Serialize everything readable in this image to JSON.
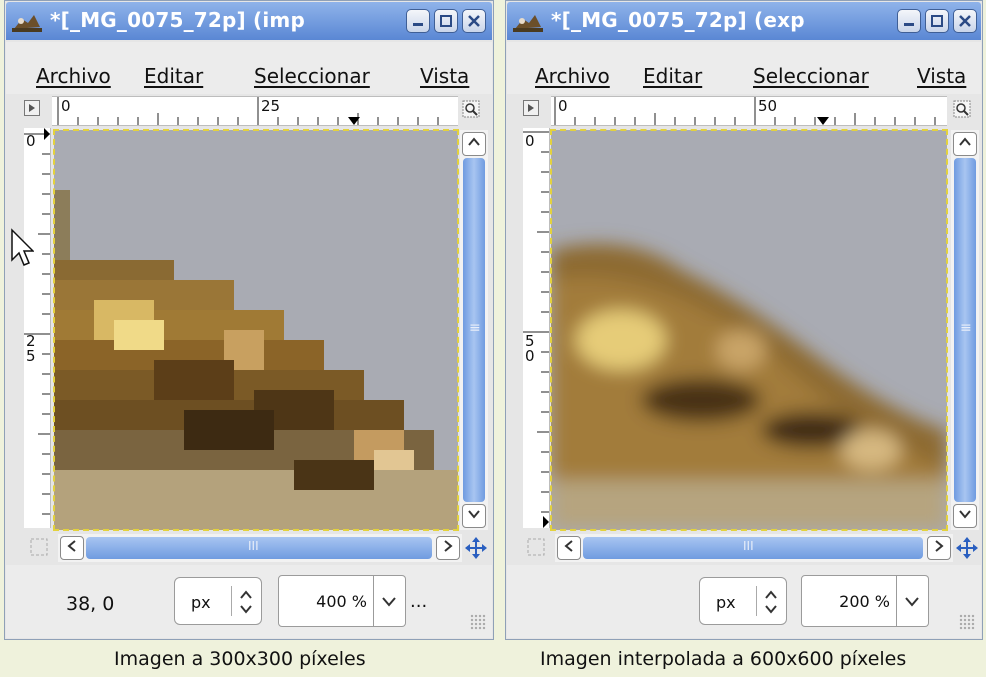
{
  "windows": {
    "left": {
      "title": "*[_MG_0075_72p] (imp",
      "menu": [
        "Archivo",
        "Editar",
        "Seleccionar",
        "Vista"
      ],
      "hruler_labels": [
        "0",
        "25"
      ],
      "vruler_labels": [
        "0",
        "2",
        "5"
      ],
      "coords": "38, 0",
      "unit": "px",
      "zoom": "400 %",
      "ellipsis": "...",
      "scroll_grip_h": "III",
      "scroll_grip_v": "≡"
    },
    "right": {
      "title": "*[_MG_0075_72p] (exp",
      "menu": [
        "Archivo",
        "Editar",
        "Seleccionar",
        "Vista"
      ],
      "hruler_labels": [
        "0",
        "50"
      ],
      "vruler_labels": [
        "0",
        "5",
        "0"
      ],
      "unit": "px",
      "zoom": "200 %",
      "scroll_grip_h": "III",
      "scroll_grip_v": "≡"
    }
  },
  "captions": {
    "left": "Imagen a 300x300 píxeles",
    "right": "Imagen interpolada a 600x600 píxeles"
  },
  "colors": {
    "titlebar": "#5a87d4",
    "scroll_thumb": "#6f9be0",
    "canvas_bg": "#a9abb3",
    "selection_outline": "#e3d23d",
    "caption_bg": "#eff2dc"
  },
  "icons": {
    "app": "gimp-wilber-icon",
    "minimize": "minimize-icon",
    "maximize": "maximize-icon",
    "close": "close-icon",
    "navigate": "four-arrow-move-icon",
    "zoom": "zoom-magnifier-icon",
    "quickmask": "quick-mask-icon"
  }
}
